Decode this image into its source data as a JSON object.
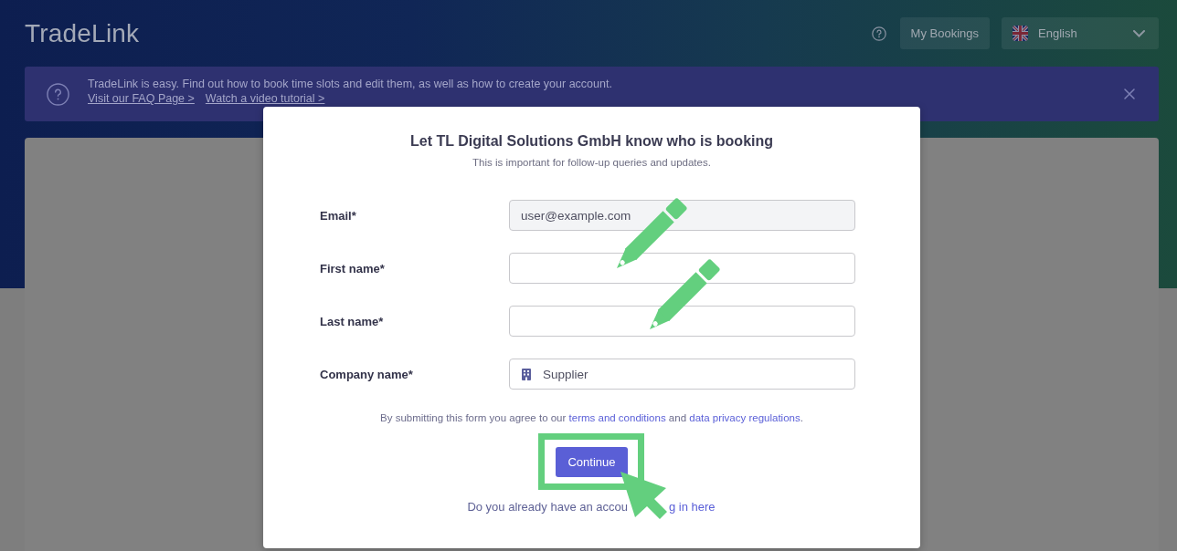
{
  "header": {
    "logo": "TradeLink",
    "my_bookings": "My Bookings",
    "language": {
      "value": "English"
    }
  },
  "banner": {
    "text": "TradeLink is easy. Find out how to book time slots and edit them, as well as how to create your account.",
    "links": [
      "Visit our FAQ Page >",
      "Watch a video tutorial >"
    ]
  },
  "dialog": {
    "title": "Let TL Digital Solutions GmbH know who is booking",
    "subtitle": "This is important for follow-up queries and updates.",
    "fields": [
      {
        "label": "Email*",
        "value": "user@example.com",
        "kind": "text",
        "disabled": true
      },
      {
        "label": "First name*",
        "kind": "text",
        "disabled": false
      },
      {
        "label": "Last name*",
        "kind": "text",
        "disabled": false
      },
      {
        "label": "Company name*",
        "value": "Supplier",
        "kind": "company",
        "disabled": false
      }
    ],
    "consent": [
      {
        "kind": "text",
        "text": "By submitting this form you agree to our "
      },
      {
        "kind": "link",
        "text": "terms and conditions"
      },
      {
        "kind": "text",
        "text": " and "
      },
      {
        "kind": "link",
        "text": "data privacy regulations"
      },
      {
        "kind": "text",
        "text": "."
      }
    ],
    "button": "Continue",
    "login_prompt": {
      "text": "Do you already have an accou",
      "link": "g in here"
    }
  }
}
